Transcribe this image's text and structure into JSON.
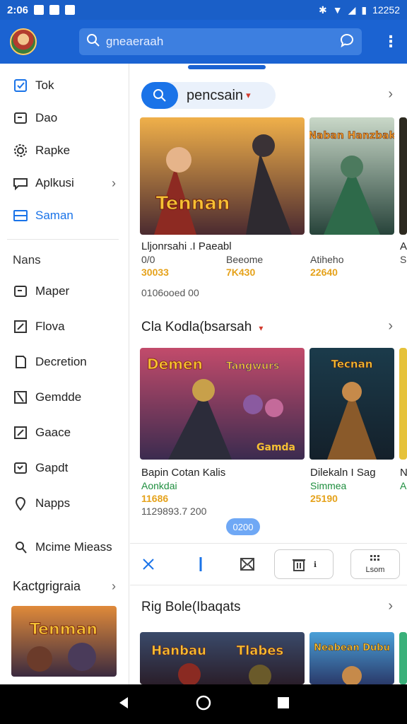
{
  "status_bar": {
    "time": "2:06",
    "right_time": "12252"
  },
  "app_bar": {
    "search_placeholder": "gneaeraah"
  },
  "sidebar": {
    "items": [
      {
        "label": "Tok",
        "icon": "checkbox-icon"
      },
      {
        "label": "Dao",
        "icon": "card-icon"
      },
      {
        "label": "Rapke",
        "icon": "gear-icon"
      },
      {
        "label": "Aplkusi",
        "icon": "chat-icon"
      },
      {
        "label": "Saman",
        "icon": "window-icon"
      }
    ],
    "section_header": "Nans",
    "section_items": [
      {
        "label": "Maper",
        "icon": "card-icon"
      },
      {
        "label": "Flova",
        "icon": "edit-icon"
      },
      {
        "label": "Decretion",
        "icon": "bookmark-icon"
      },
      {
        "label": "Gemdde",
        "icon": "flag-icon"
      },
      {
        "label": "Gaace",
        "icon": "edit-icon"
      },
      {
        "label": "Gapdt",
        "icon": "card-icon"
      },
      {
        "label": "Napps",
        "icon": "pin-icon"
      },
      {
        "label": "Mcime Mieass",
        "icon": "person-icon"
      }
    ],
    "categories_label": "Kactgrigraia"
  },
  "main": {
    "chip_label": "pencsain",
    "section1": {
      "cards": [
        {
          "title": "Lljonrsahi .I Paeabl",
          "subtitle": "0/0",
          "subtitle2": "Beeome",
          "price": "30033",
          "price2": "7K430"
        },
        {
          "title": "Atiheho",
          "price": "22640"
        },
        {
          "title": "A",
          "subtitle": "S"
        }
      ],
      "meta": "0106ooed 00"
    },
    "section2": {
      "title": "Cla Kodla(bsarsah",
      "cards": [
        {
          "title": "Bapin Cotan Kalis",
          "subtitle": "Aonkdai",
          "price": "11686",
          "meta": "1129893.7 200"
        },
        {
          "title": "Dilekaln I Sag",
          "subtitle": "Simmea",
          "price": "25190"
        },
        {
          "title": "N",
          "subtitle": "A"
        }
      ]
    },
    "page_indicator": "0200",
    "toolbar": {
      "box2_label": "Lsom"
    },
    "section3": {
      "title": "Rig Bole(Ibaqats"
    }
  },
  "images": {
    "card1": "Tennan",
    "card2": "Naban Hanzbak",
    "card4": "Demen",
    "card4b": "Tangwurs",
    "card4c": "Gamda",
    "card5": "Tecnan",
    "card7": "Hanbau",
    "card8": "Tlabes",
    "card9": "Neabean Dubu",
    "cat": "Tenman"
  },
  "colors": {
    "accent": "#1a73e8",
    "appbar": "#1b63d2",
    "price": "#e5a21b",
    "green": "#1e8e3e"
  }
}
